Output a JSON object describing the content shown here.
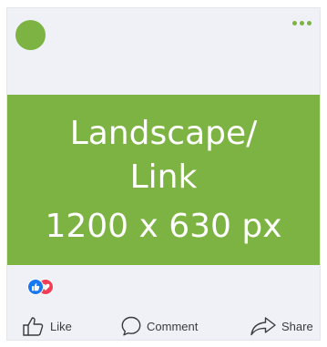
{
  "colors": {
    "brand_green": "#7cb342",
    "facebook_blue": "#1877f2",
    "love_red": "#f33e58",
    "card_bg": "#eff1f6",
    "text_gray": "#3a3b3c"
  },
  "header": {
    "avatar_icon": "avatar-circle",
    "menu_icon": "more-horizontal-icon"
  },
  "banner": {
    "lines": [
      "Landscape/",
      "Link",
      "1200 x 630 px"
    ]
  },
  "reactions": {
    "icons": [
      "like-reaction-icon",
      "love-reaction-icon"
    ]
  },
  "actions": {
    "like_label": "Like",
    "comment_label": "Comment",
    "share_label": "Share"
  }
}
